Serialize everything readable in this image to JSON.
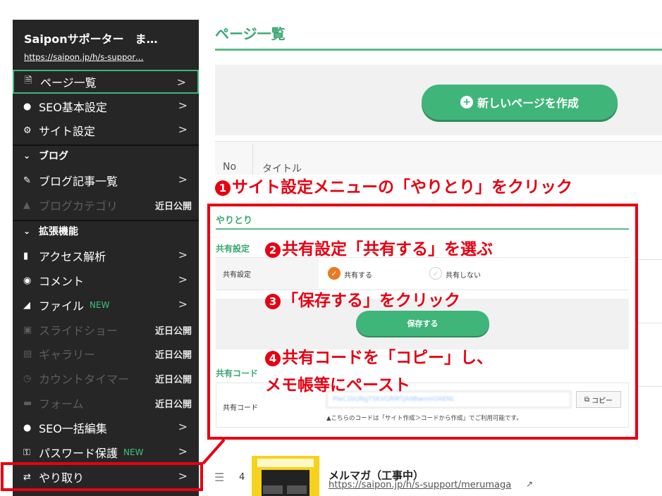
{
  "sidebar": {
    "site_title": "Saiponサポーター　ま…",
    "site_url": "https://saipon.jp/h/s-suppor…",
    "items": [
      {
        "label": "ページ一覧",
        "icon": "document-icon",
        "chevron": ">"
      },
      {
        "label": "SEO基本設定",
        "icon": "globe-icon",
        "chevron": ">"
      },
      {
        "label": "サイト設定",
        "icon": "gear-icon",
        "chevron": ">"
      },
      {
        "label": "ブログ記事一覧",
        "icon": "edit-icon",
        "chevron": ">"
      },
      {
        "label": "ブログカテゴリ",
        "icon": "sitemap-icon",
        "status": "近日公開"
      },
      {
        "label": "アクセス解析",
        "icon": "bar-chart-icon",
        "chevron": ">"
      },
      {
        "label": "コメント",
        "icon": "comment-icon",
        "chevron": ">"
      },
      {
        "label": "ファイル",
        "icon": "folder-icon",
        "badge": "NEW",
        "chevron": ">"
      },
      {
        "label": "スライドショー",
        "icon": "film-icon",
        "status": "近日公開"
      },
      {
        "label": "ギャラリー",
        "icon": "image-icon",
        "status": "近日公開"
      },
      {
        "label": "カウントタイマー",
        "icon": "clock-icon",
        "status": "近日公開"
      },
      {
        "label": "フォーム",
        "icon": "form-icon",
        "status": "近日公開"
      },
      {
        "label": "SEO一括編集",
        "icon": "globe-icon",
        "chevron": ">"
      },
      {
        "label": "パスワード保護",
        "icon": "key-icon",
        "badge": "NEW",
        "chevron": ">"
      },
      {
        "label": "やり取り",
        "icon": "exchange-icon",
        "chevron": ">"
      }
    ],
    "sections": {
      "blog": "ブログ",
      "extensions": "拡張機能"
    }
  },
  "main": {
    "page_title": "ページ一覧",
    "new_page_button": "新しいページを作成",
    "table_headers": {
      "no": "No",
      "title": "タイトル"
    }
  },
  "modal": {
    "title": "やりとり",
    "share_setting_section": "共有設定",
    "share_setting_label": "共有設定",
    "option_share": "共有する",
    "option_no_share": "共有しない",
    "save_button": "保存する",
    "share_code_section": "共有コード",
    "share_code_label": "共有コード",
    "share_code_value": "PlaC1bUNgT5KVQRMTJA9BwnmOAENL",
    "copy_button": "コピー",
    "note": "▲こちらのコードは「サイト作成＞コードから作成」でご利用可能です。"
  },
  "annotations": {
    "step1": "サイト設定メニューの「やりとり」をクリック",
    "step2": "共有設定「共有する」を選ぶ",
    "step3": "「保存する」をクリック",
    "step4_line1": "共有コードを「コピー」し、",
    "step4_line2": "メモ帳等にペースト",
    "num1": "1",
    "num2": "2",
    "num3": "3",
    "num4": "4"
  },
  "list_row": {
    "no": "4",
    "title": "メルマガ（工事中）",
    "url": "https://saipon.jp/h/s-support/merumaga"
  },
  "colors": {
    "accent": "#3fb57a",
    "annotation": "#e60012",
    "sidebar_bg": "#262626"
  }
}
